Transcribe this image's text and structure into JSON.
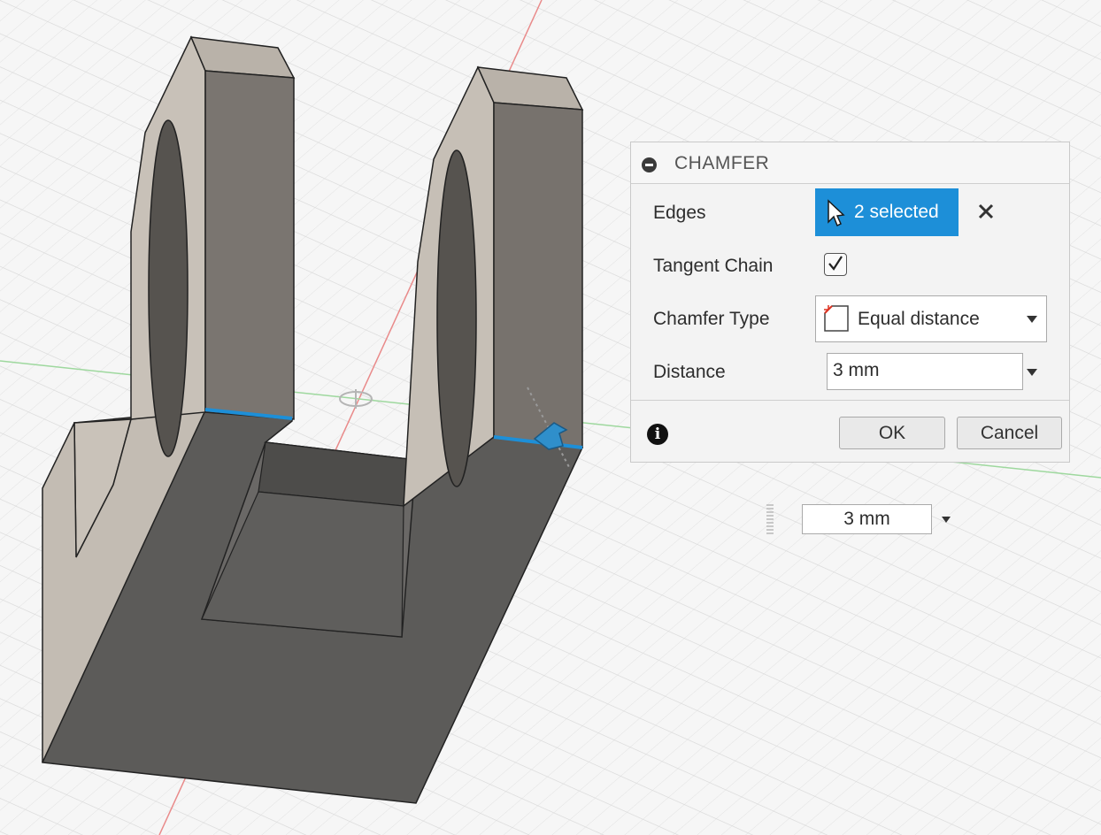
{
  "viewport": {
    "label": "3D model viewport"
  },
  "chamfer_panel": {
    "title": "CHAMFER",
    "edges": {
      "label": "Edges",
      "selection": "2 selected"
    },
    "tangent_chain": {
      "label": "Tangent Chain",
      "checked": true
    },
    "chamfer_type": {
      "label": "Chamfer Type",
      "value": "Equal distance"
    },
    "distance": {
      "label": "Distance",
      "value": "3 mm"
    },
    "ok_label": "OK",
    "cancel_label": "Cancel"
  },
  "floating_distance": {
    "value": "3 mm"
  },
  "colors": {
    "accent": "#1d8fd8",
    "body_face_light": "#c6bfb6",
    "body_face_dark": "#5a5957",
    "axis_red": "#e04b4b",
    "axis_green": "#69c96a"
  }
}
